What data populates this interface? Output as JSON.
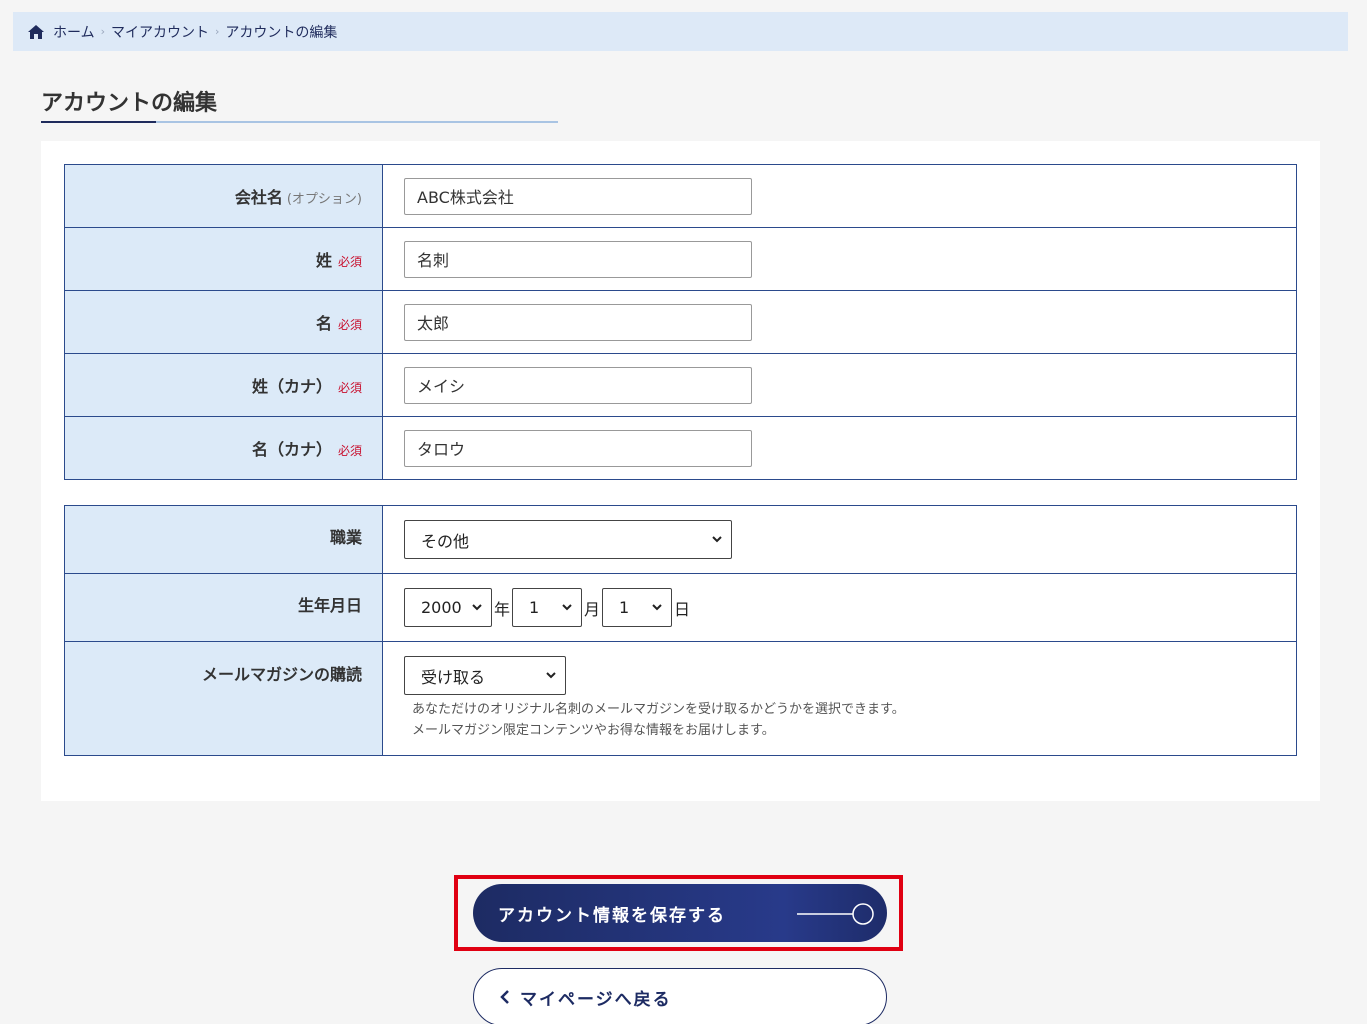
{
  "breadcrumb": {
    "home": "ホーム",
    "my_account": "マイアカウント",
    "current": "アカウントの編集",
    "separator": "›"
  },
  "page": {
    "title": "アカウントの編集"
  },
  "labels": {
    "required": "必須",
    "optional": "(オプション)"
  },
  "form1": {
    "company": {
      "label": "会社名",
      "value": "ABC株式会社"
    },
    "last_name": {
      "label": "姓",
      "value": "名刺"
    },
    "first_name": {
      "label": "名",
      "value": "太郎"
    },
    "last_name_kana": {
      "label": "姓（カナ）",
      "value": "メイシ"
    },
    "first_name_kana": {
      "label": "名（カナ）",
      "value": "タロウ"
    }
  },
  "form2": {
    "occupation": {
      "label": "職業",
      "value": "その他"
    },
    "birthday": {
      "label": "生年月日",
      "year": "2000",
      "year_unit": "年",
      "month": "1",
      "month_unit": "月",
      "day": "1",
      "day_unit": "日"
    },
    "newsletter": {
      "label": "メールマガジンの購読",
      "value": "受け取る",
      "help1": "あなただけのオリジナル名刺のメールマガジンを受け取るかどうかを選択できます。",
      "help2": "メールマガジン限定コンテンツやお得な情報をお届けします。"
    }
  },
  "buttons": {
    "save": "アカウント情報を保存する",
    "back": "マイページへ戻る"
  },
  "colors": {
    "navy": "#1d2b63",
    "highlight": "#e00012",
    "required": "#c8102e",
    "label_bg": "#dceaf8"
  }
}
